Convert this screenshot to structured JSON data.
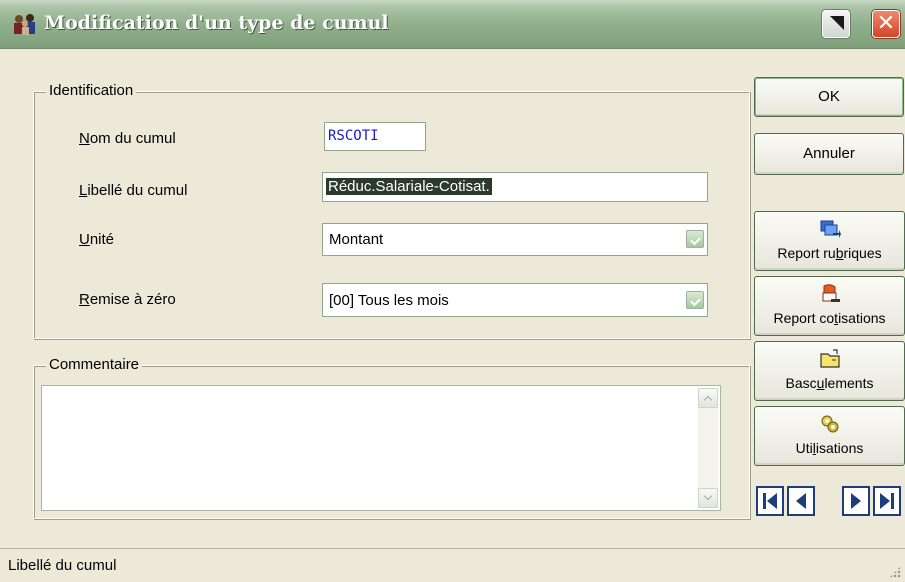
{
  "window": {
    "title": "Modification d'un type de cumul",
    "icon": "users-icon",
    "minimize_icon": "minimize-icon",
    "close_icon": "close-icon",
    "close_glyph": "✕",
    "titlebar_color": "#8fad8a"
  },
  "identification": {
    "legend": "Identification",
    "nom": {
      "label_key": "N",
      "label_rest": "om du cumul",
      "value": "RSCOTI"
    },
    "libelle": {
      "label_key": "L",
      "label_rest": "ibellé du cumul",
      "value": "Réduc.Salariale-Cotisat."
    },
    "unite": {
      "label_key": "U",
      "label_rest": "nité",
      "value": "Montant"
    },
    "remise": {
      "label_key": "R",
      "label_rest": "emise à zéro",
      "value": "[00] Tous les mois"
    }
  },
  "commentaire": {
    "legend": "Commentaire",
    "value": ""
  },
  "buttons": {
    "ok": "OK",
    "annuler": "Annuler",
    "report_rubriques": {
      "pre": "Report ru",
      "key": "b",
      "post": "riques",
      "icon": "report-rubriques-icon"
    },
    "report_cotisations": {
      "pre": "Report co",
      "key": "t",
      "post": "isations",
      "icon": "report-cotisations-icon"
    },
    "basculements": {
      "pre": "Basc",
      "key": "u",
      "post": "lements",
      "icon": "basculements-icon"
    },
    "utilisations": {
      "pre": "Uti",
      "key": "l",
      "post": "isations",
      "icon": "utilisations-icon"
    }
  },
  "navigation": [
    "first-record-icon",
    "previous-record-icon",
    "next-record-icon",
    "last-record-icon"
  ],
  "status": {
    "text": "Libellé du cumul"
  }
}
